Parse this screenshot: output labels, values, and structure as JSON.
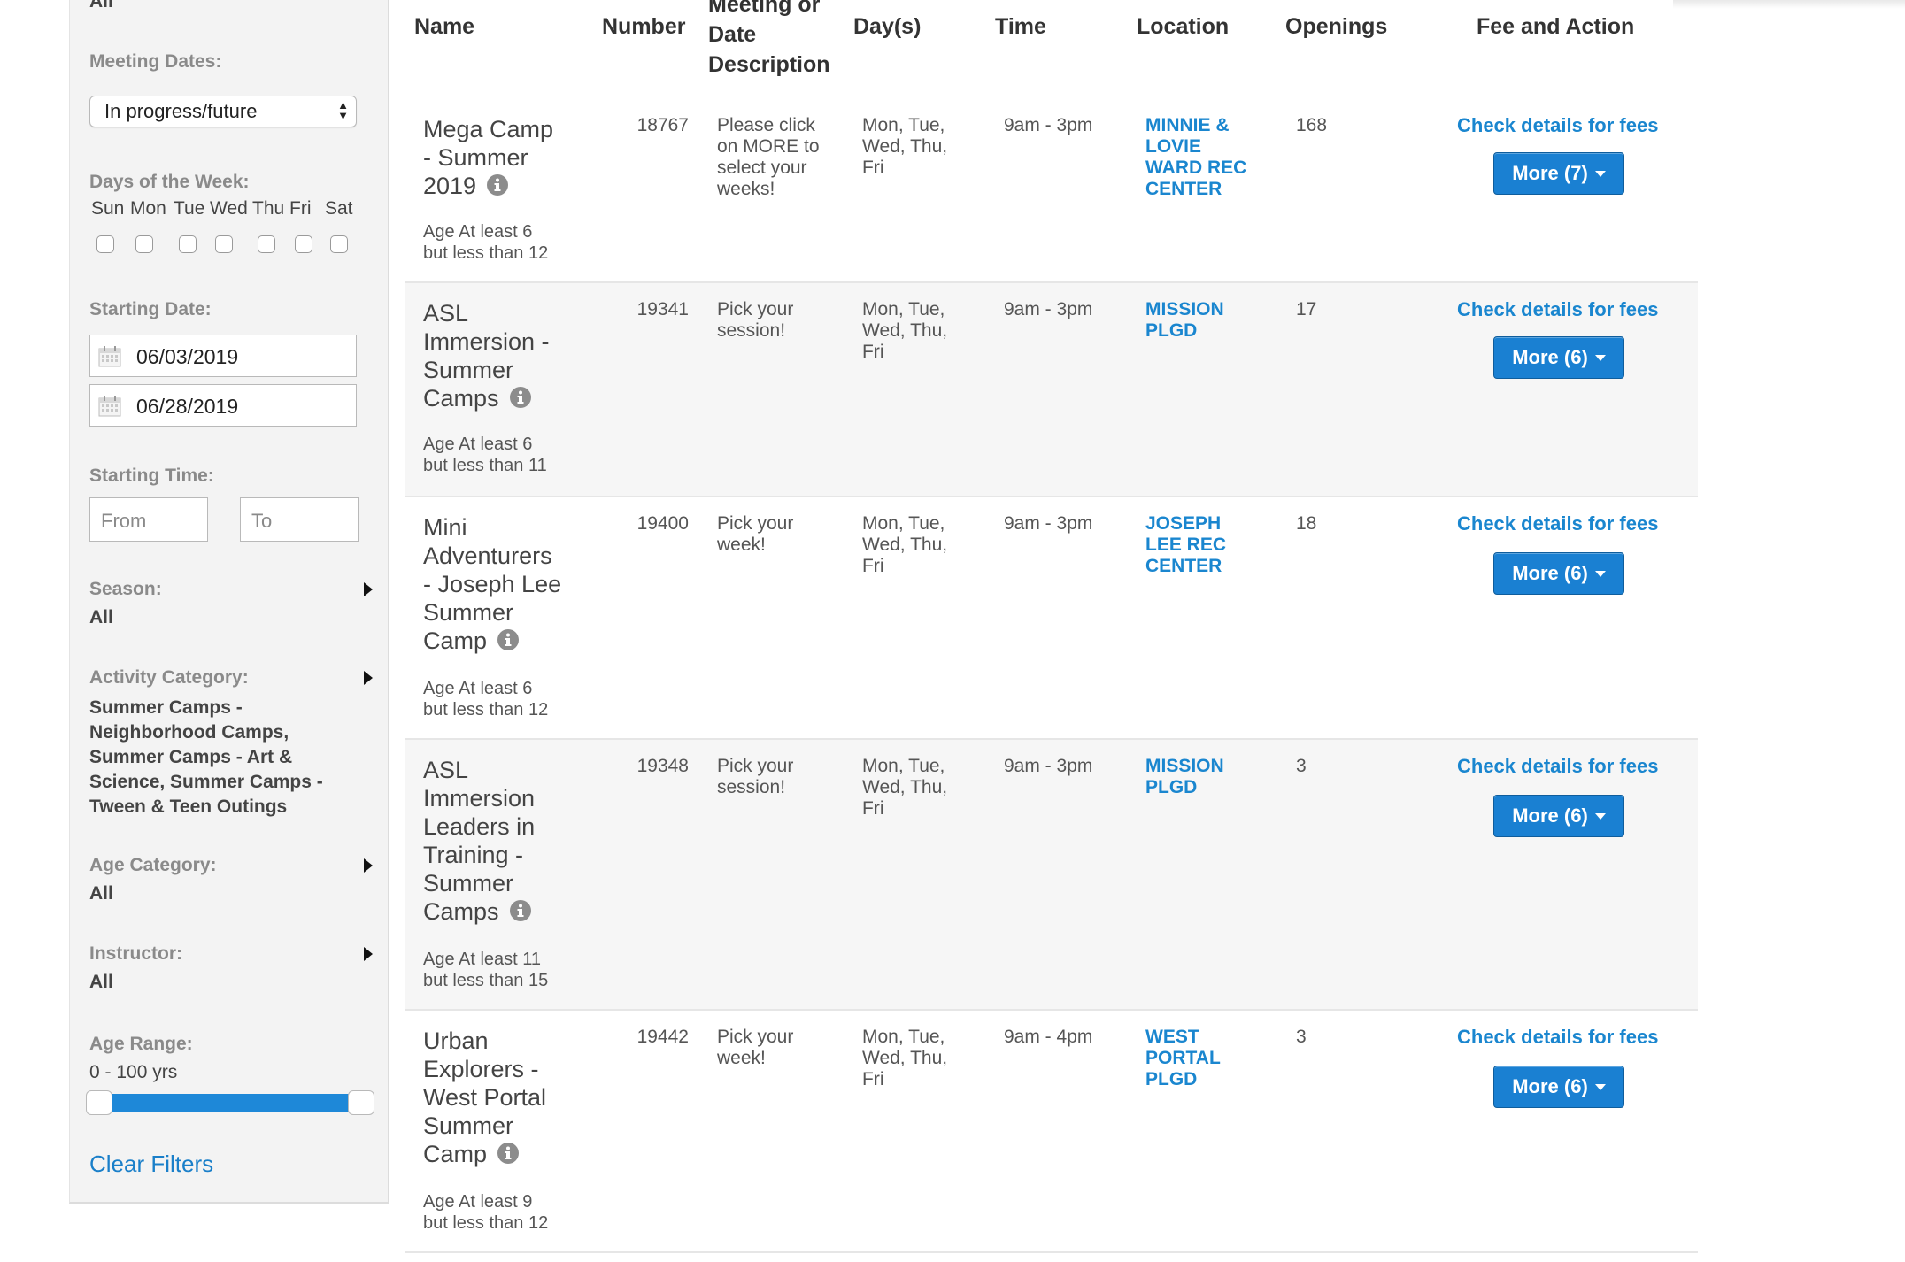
{
  "sidebar": {
    "top_value": "All",
    "meeting_dates": {
      "label": "Meeting Dates:",
      "selected": "In progress/future"
    },
    "days_of_week": {
      "label": "Days of the Week:",
      "days": [
        "Sun",
        "Mon",
        "Tue",
        "Wed",
        "Thu",
        "Fri",
        "Sat"
      ]
    },
    "starting_date": {
      "label": "Starting Date:",
      "from": "06/03/2019",
      "to": "06/28/2019"
    },
    "starting_time": {
      "label": "Starting Time:",
      "from_placeholder": "From",
      "to_placeholder": "To"
    },
    "season": {
      "label": "Season:",
      "value": "All"
    },
    "activity_category": {
      "label": "Activity Category:",
      "value_lines": [
        "Summer Camps -",
        "Neighborhood Camps,",
        "Summer Camps - Art &",
        "Science, Summer Camps -",
        "Tween & Teen Outings"
      ]
    },
    "age_category": {
      "label": "Age Category:",
      "value": "All"
    },
    "instructor": {
      "label": "Instructor:",
      "value": "All"
    },
    "age_range": {
      "label": "Age Range:",
      "value": "0 - 100 yrs",
      "min": 0,
      "max": 100
    },
    "clear_filters": "Clear Filters"
  },
  "table": {
    "headers": {
      "name": "Name",
      "number": "Number",
      "meeting": [
        "Meeting or",
        "Date",
        "Description"
      ],
      "days": "Day(s)",
      "time": "Time",
      "location": "Location",
      "openings": "Openings",
      "fee": "Fee and Action"
    },
    "rows": [
      {
        "name_lines": [
          "Mega Camp",
          "- Summer",
          "2019"
        ],
        "age_lines": [
          "Age At least 6",
          "but less than 12"
        ],
        "number": "18767",
        "desc_lines": [
          "Please click",
          "on MORE to",
          "select your",
          "weeks!"
        ],
        "days_lines": [
          "Mon, Tue,",
          "Wed, Thu,",
          "Fri"
        ],
        "time": "9am - 3pm",
        "location_lines": [
          "MINNIE &",
          "LOVIE",
          "WARD REC",
          "CENTER"
        ],
        "openings": "168",
        "fee": "Check details for fees",
        "more": "More (7)"
      },
      {
        "name_lines": [
          "ASL",
          "Immersion -",
          "Summer",
          "Camps"
        ],
        "age_lines": [
          "Age At least 6",
          "but less than 11"
        ],
        "number": "19341",
        "desc_lines": [
          "Pick your",
          "session!"
        ],
        "days_lines": [
          "Mon, Tue,",
          "Wed, Thu,",
          "Fri"
        ],
        "time": "9am - 3pm",
        "location_lines": [
          "MISSION",
          "PLGD"
        ],
        "openings": "17",
        "fee": "Check details for fees",
        "more": "More (6)"
      },
      {
        "name_lines": [
          "Mini",
          "Adventurers",
          "- Joseph Lee",
          "Summer",
          "Camp"
        ],
        "age_lines": [
          "Age At least 6",
          "but less than 12"
        ],
        "number": "19400",
        "desc_lines": [
          "Pick your",
          "week!"
        ],
        "days_lines": [
          "Mon, Tue,",
          "Wed, Thu,",
          "Fri"
        ],
        "time": "9am - 3pm",
        "location_lines": [
          "JOSEPH",
          "LEE REC",
          "CENTER"
        ],
        "openings": "18",
        "fee": "Check details for fees",
        "more": "More (6)"
      },
      {
        "name_lines": [
          "ASL",
          "Immersion",
          "Leaders in",
          "Training -",
          "Summer",
          "Camps"
        ],
        "age_lines": [
          "Age At least 11",
          "but less than 15"
        ],
        "number": "19348",
        "desc_lines": [
          "Pick your",
          "session!"
        ],
        "days_lines": [
          "Mon, Tue,",
          "Wed, Thu,",
          "Fri"
        ],
        "time": "9am - 3pm",
        "location_lines": [
          "MISSION",
          "PLGD"
        ],
        "openings": "3",
        "fee": "Check details for fees",
        "more": "More (6)"
      },
      {
        "name_lines": [
          "Urban",
          "Explorers -",
          "West Portal",
          "Summer",
          "Camp"
        ],
        "age_lines": [
          "Age At least 9",
          "but less than 12"
        ],
        "number": "19442",
        "desc_lines": [
          "Pick your",
          "week!"
        ],
        "days_lines": [
          "Mon, Tue,",
          "Wed, Thu,",
          "Fri"
        ],
        "time": "9am - 4pm",
        "location_lines": [
          "WEST",
          "PORTAL",
          "PLGD"
        ],
        "openings": "3",
        "fee": "Check details for fees",
        "more": "More (6)"
      }
    ]
  }
}
